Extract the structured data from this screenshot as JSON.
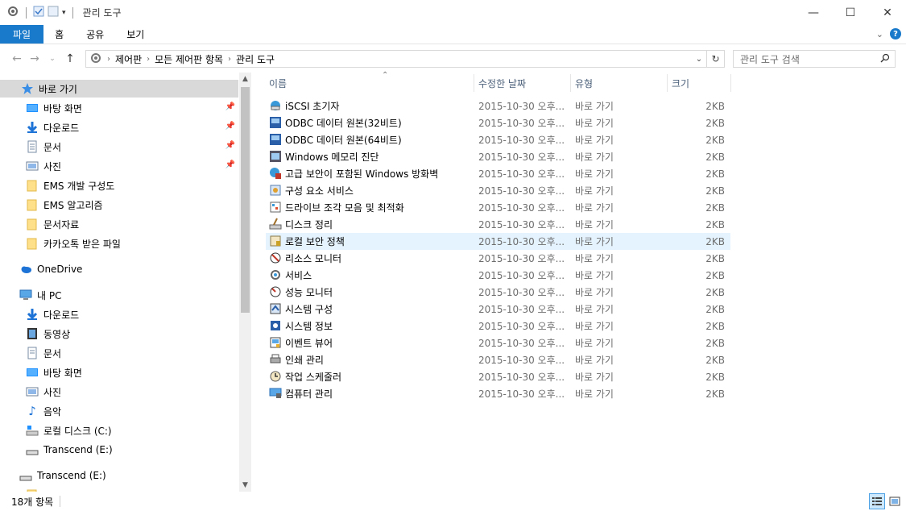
{
  "window": {
    "title": "관리 도구",
    "controls": {
      "minimize": "—",
      "maximize": "☐",
      "close": "✕"
    }
  },
  "ribbon": {
    "tabs": [
      "파일",
      "홈",
      "공유",
      "보기"
    ]
  },
  "address": {
    "crumbs": [
      "제어판",
      "모든 제어판 항목",
      "관리 도구"
    ]
  },
  "search": {
    "placeholder": "관리 도구 검색"
  },
  "nav": {
    "quick_access": "바로 가기",
    "pinned": [
      "바탕 화면",
      "다운로드",
      "문서",
      "사진"
    ],
    "folders": [
      "EMS 개발 구성도",
      "EMS 알고리즘",
      "문서자료",
      "카카오톡 받은 파일"
    ],
    "onedrive": "OneDrive",
    "this_pc": "내 PC",
    "pc_items": [
      "다운로드",
      "동영상",
      "문서",
      "바탕 화면",
      "사진",
      "음악",
      "로컬 디스크 (C:)",
      "Transcend (E:)"
    ],
    "drive": "Transcend (E:)"
  },
  "columns": {
    "name": "이름",
    "date": "수정한 날짜",
    "type": "유형",
    "size": "크기"
  },
  "files": [
    {
      "name": "iSCSI 초기자",
      "date": "2015-10-30 오후...",
      "type": "바로 가기",
      "size": "2KB",
      "icon": "iscsi-icon"
    },
    {
      "name": "ODBC 데이터 원본(32비트)",
      "date": "2015-10-30 오후...",
      "type": "바로 가기",
      "size": "2KB",
      "icon": "odbc-icon"
    },
    {
      "name": "ODBC 데이터 원본(64비트)",
      "date": "2015-10-30 오후...",
      "type": "바로 가기",
      "size": "2KB",
      "icon": "odbc-icon"
    },
    {
      "name": "Windows 메모리 진단",
      "date": "2015-10-30 오후...",
      "type": "바로 가기",
      "size": "2KB",
      "icon": "memory-icon"
    },
    {
      "name": "고급 보안이 포함된 Windows 방화벽",
      "date": "2015-10-30 오후...",
      "type": "바로 가기",
      "size": "2KB",
      "icon": "firewall-icon"
    },
    {
      "name": "구성 요소 서비스",
      "date": "2015-10-30 오후...",
      "type": "바로 가기",
      "size": "2KB",
      "icon": "components-icon"
    },
    {
      "name": "드라이브 조각 모음 및 최적화",
      "date": "2015-10-30 오후...",
      "type": "바로 가기",
      "size": "2KB",
      "icon": "defrag-icon"
    },
    {
      "name": "디스크 정리",
      "date": "2015-10-30 오후...",
      "type": "바로 가기",
      "size": "2KB",
      "icon": "cleanup-icon"
    },
    {
      "name": "로컬 보안 정책",
      "date": "2015-10-30 오후...",
      "type": "바로 가기",
      "size": "2KB",
      "icon": "security-policy-icon"
    },
    {
      "name": "리소스 모니터",
      "date": "2015-10-30 오후...",
      "type": "바로 가기",
      "size": "2KB",
      "icon": "resource-monitor-icon"
    },
    {
      "name": "서비스",
      "date": "2015-10-30 오후...",
      "type": "바로 가기",
      "size": "2KB",
      "icon": "services-icon"
    },
    {
      "name": "성능 모니터",
      "date": "2015-10-30 오후...",
      "type": "바로 가기",
      "size": "2KB",
      "icon": "performance-icon"
    },
    {
      "name": "시스템 구성",
      "date": "2015-10-30 오후...",
      "type": "바로 가기",
      "size": "2KB",
      "icon": "sysconfig-icon"
    },
    {
      "name": "시스템 정보",
      "date": "2015-10-30 오후...",
      "type": "바로 가기",
      "size": "2KB",
      "icon": "sysinfo-icon"
    },
    {
      "name": "이벤트 뷰어",
      "date": "2015-10-30 오후...",
      "type": "바로 가기",
      "size": "2KB",
      "icon": "event-viewer-icon"
    },
    {
      "name": "인쇄 관리",
      "date": "2015-10-30 오후...",
      "type": "바로 가기",
      "size": "2KB",
      "icon": "print-icon"
    },
    {
      "name": "작업 스케줄러",
      "date": "2015-10-30 오후...",
      "type": "바로 가기",
      "size": "2KB",
      "icon": "scheduler-icon"
    },
    {
      "name": "컴퓨터 관리",
      "date": "2015-10-30 오후...",
      "type": "바로 가기",
      "size": "2KB",
      "icon": "computer-management-icon"
    }
  ],
  "status": {
    "count": "18개 항목"
  },
  "colors": {
    "accent": "#1979ca",
    "hover_row": "#e5f3ff",
    "selected_nav": "#d9d9d9"
  }
}
